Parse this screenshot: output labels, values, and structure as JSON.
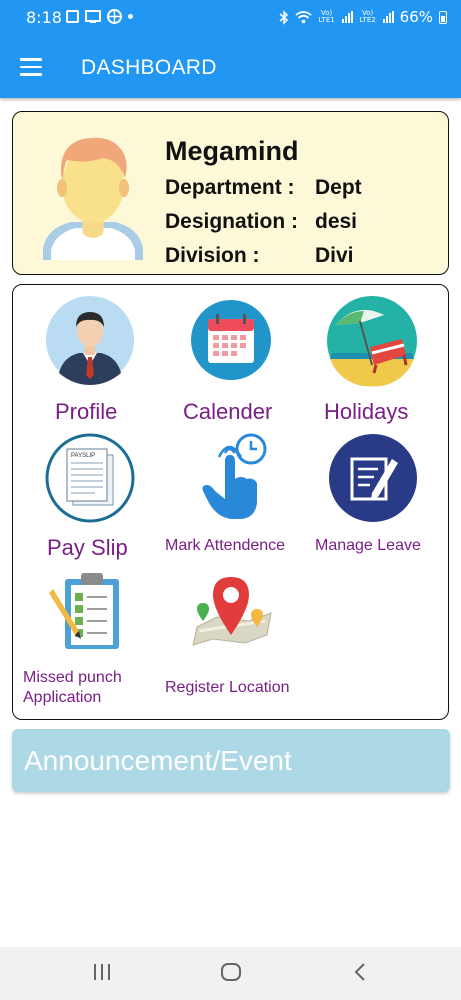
{
  "status_bar": {
    "time": "8:18",
    "battery": "66%",
    "sim1": "Vo) LTE1",
    "sim2": "Vo) LTE2",
    "icons": [
      "gallery-icon",
      "cast-icon",
      "soccer-icon",
      "dot-icon",
      "bluetooth-icon",
      "wifi-icon",
      "signal-icon",
      "battery-icon"
    ]
  },
  "app_bar": {
    "title": "DASHBOARD",
    "menu_icon": "hamburger-menu-icon"
  },
  "profile": {
    "name": "Megamind",
    "department_label": "Department :",
    "department_value": "Dept",
    "designation_label": "Designation :",
    "designation_value": "desi",
    "division_label": "Division :",
    "division_value": "Divi",
    "avatar_icon": "person-avatar-icon"
  },
  "menu": {
    "profile": "Profile",
    "calender": "Calender",
    "holidays": "Holidays",
    "pay_slip": "Pay Slip",
    "mark_attendence": "Mark Attendence",
    "manage_leave": "Manage Leave",
    "missed_punch_line1": "Missed punch",
    "missed_punch_line2": "Application",
    "register_location": "Register Location"
  },
  "announcement": {
    "label": "Announcement/Event"
  },
  "colors": {
    "primary": "#2196f3",
    "menu_label": "#7a1f86",
    "profile_card_bg": "#fdf8d8",
    "announcement_bg": "#add8e6"
  },
  "nav_bar": {
    "icons": [
      "recent-apps-icon",
      "home-icon",
      "back-icon"
    ]
  }
}
